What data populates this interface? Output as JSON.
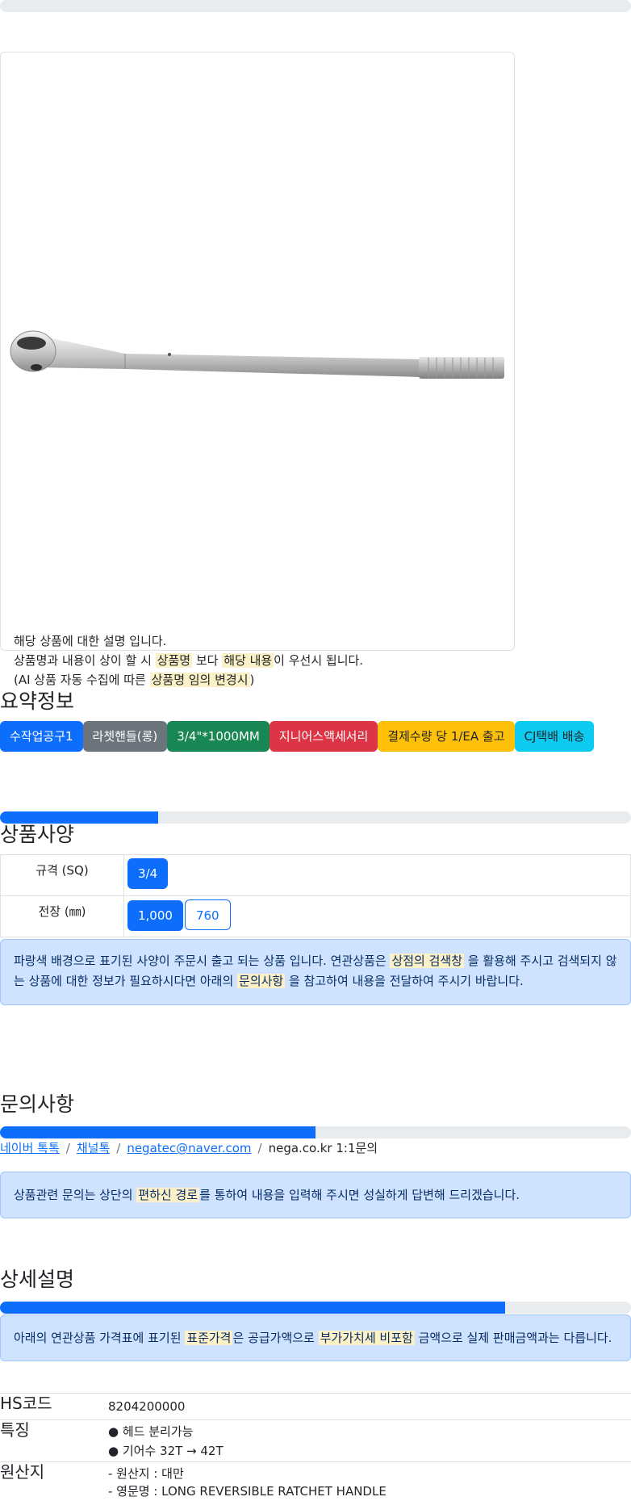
{
  "product_card": {
    "desc_line1": "해당 상품에 대한 설명 입니다.",
    "desc_line2_a": "상품명과 내용이 상이 할 시 ",
    "desc_line2_mark1": "상품명",
    "desc_line2_b": " 보다 ",
    "desc_line2_mark2": "해당 내용",
    "desc_line2_c": "이 우선시 됩니다.",
    "desc_line3_a": "(AI 상품 자동 수집에 따른 ",
    "desc_line3_mark": "상품명 임의 변경시",
    "desc_line3_b": ")"
  },
  "summary": {
    "title": "요약정보",
    "badges": [
      "수작업공구1",
      "라쳇핸들(롱)",
      "3/4\"*1000MM",
      "지니어스액세서리",
      "결제수량 당 1/EA 출고",
      "CJ택배 배송"
    ]
  },
  "spec": {
    "title": "상품사양",
    "progress": 0.25,
    "rows": [
      {
        "label": "규격 (SQ)",
        "options": [
          "3/4"
        ]
      },
      {
        "label": "전장 (㎜)",
        "options": [
          "1,000",
          "760"
        ]
      }
    ],
    "notice_a": "파랑색 배경으로 표기된 사양이 주문시 출고 되는 상품 입니다. 연관상품은 ",
    "notice_mark1": "상점의 검색창",
    "notice_b": " 을 활용해 주시고 검색되지 않는 상품에 대한 정보가 필요하시다면 아래의 ",
    "notice_mark2": "문의사항",
    "notice_c": " 을 참고하여 내용을 전달하여 주시기 바랍니다."
  },
  "inquiry": {
    "title": "문의사항",
    "progress": 0.5,
    "links": [
      "네이버 톡톡",
      "채널톡",
      "negatec@naver.com"
    ],
    "plain": "nega.co.kr 1:1문의",
    "separator": "/",
    "notice_a": "상품관련 문의는 상단의 ",
    "notice_mark": "편하신 경로",
    "notice_b": "를 통하여 내용을 입력해 주시면 성실하게 답변해 드리겠습니다."
  },
  "detail": {
    "title": "상세설명",
    "progress": 0.8,
    "notice_a": "아래의 연관상품 가격표에 표기된 ",
    "notice_mark1": "표준가격",
    "notice_b": "은 공급가액으로 ",
    "notice_mark2": "부가가치세 비포함",
    "notice_c": " 금액으로 실제 판매금액과는 다릅니다.",
    "rows": [
      {
        "key": "HS코드",
        "lines": [
          "8204200000"
        ]
      },
      {
        "key": "특징",
        "lines": [
          "● 헤드 분리가능",
          "● 기어수 32T → 42T"
        ]
      },
      {
        "key": "원산지",
        "lines": [
          "- 원산지 : 대만",
          "- 영문명 : LONG REVERSIBLE RATCHET HANDLE"
        ]
      }
    ]
  },
  "colors": {
    "primary": "#0d6efd",
    "secondary": "#6c757d",
    "success": "#198754",
    "danger": "#dc3545",
    "warning": "#ffc107",
    "info": "#0dcaf0",
    "highlight": "#fcf0c6"
  }
}
